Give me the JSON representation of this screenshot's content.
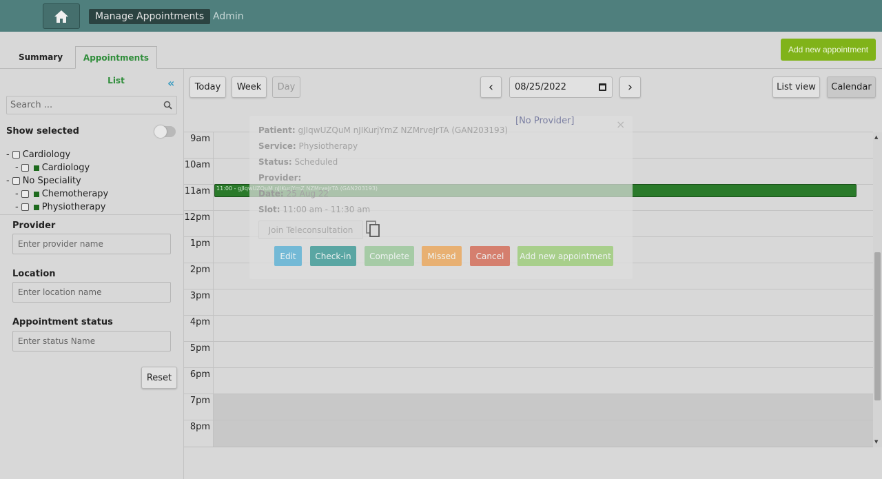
{
  "nav": {
    "home_icon": "home-icon",
    "manage": "Manage Appointments",
    "admin": "Admin"
  },
  "tabs": {
    "summary": "Summary",
    "list": "Appointments List"
  },
  "add_new": "Add new appointment",
  "sidebar": {
    "collapse_icon": "«",
    "search_placeholder": "Search ...",
    "show_selected": "Show selected",
    "tree": [
      {
        "prefix": "-",
        "label": "Cardiology",
        "child": false
      },
      {
        "prefix": "-",
        "label": "Cardiology",
        "child": true
      },
      {
        "prefix": "-",
        "label": "No Speciality",
        "child": false
      },
      {
        "prefix": "-",
        "label": "Chemotherapy",
        "child": true
      },
      {
        "prefix": "-",
        "label": "Physiotherapy",
        "child": true
      }
    ],
    "provider_label": "Provider",
    "provider_placeholder": "Enter provider name",
    "location_label": "Location",
    "location_placeholder": "Enter location name",
    "status_label": "Appointment status",
    "status_placeholder": "Enter status Name",
    "reset": "Reset"
  },
  "toolbar": {
    "today": "Today",
    "week": "Week",
    "day": "Day",
    "prev": "‹",
    "next": "›",
    "date": "08/25/2022",
    "list_view": "List view",
    "calendar": "Calendar"
  },
  "hours": [
    "9am",
    "10am",
    "11am",
    "12pm",
    "1pm",
    "2pm",
    "3pm",
    "4pm",
    "5pm",
    "6pm",
    "7pm",
    "8pm"
  ],
  "event_text": "11:00 - gJIqwUZQuM nJIKurjYmZ NZMrveJrTA (GAN203193)",
  "popup": {
    "title": "[No Provider]",
    "close": "×",
    "patient_label": "Patient:",
    "patient": "gJIqwUZQuM nJIKurjYmZ NZMrveJrTA (GAN203193)",
    "service_label": "Service:",
    "service": "Physiotherapy",
    "status_label": "Status:",
    "status": "Scheduled",
    "provider_label": "Provider:",
    "date_label": "Date:",
    "date": "25 Aug 22",
    "slot_label": "Slot:",
    "slot": "11:00 am - 11:30 am",
    "tele": "Join Teleconsultation",
    "edit": "Edit",
    "checkin": "Check-in",
    "complete": "Complete",
    "missed": "Missed",
    "cancel": "Cancel",
    "add": "Add new appointment"
  },
  "colors": {
    "nav": "#4f7f7d",
    "add_button": "#80b319",
    "event": "#2a7a2a",
    "edit": "#73b9d6",
    "checkin": "#5aa6a3",
    "complete": "#a6cba6",
    "missed": "#e8b072",
    "cancel": "#d57f6e",
    "add_popup": "#a8cf8b"
  }
}
